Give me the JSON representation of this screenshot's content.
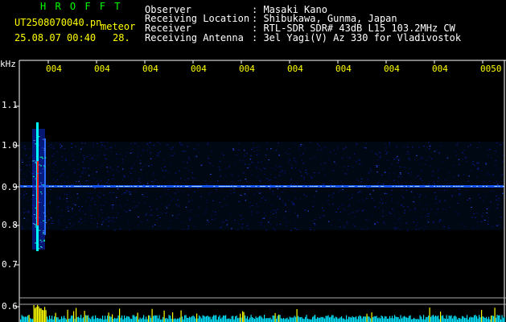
{
  "header": {
    "brand": "H R O F F T",
    "filename": "UT2508070040.pn",
    "mode": "meteor",
    "datetime": "25.08.07 00:40",
    "count": "28.",
    "fields": [
      {
        "label": "Observer",
        "value": ": Masaki Kano"
      },
      {
        "label": "Receiving Location",
        "value": ": Shibukawa, Gunma, Japan"
      },
      {
        "label": "Receiver",
        "value": ": RTL-SDR SDR# 43dB L15 103.2MHz CW"
      },
      {
        "label": "Receiving Antenna",
        "value": ": 3el Yagi(V) Az 330 for Vladivostok"
      }
    ]
  },
  "spectrogram": {
    "unit": "kHz",
    "time_ticks": [
      "004",
      "004",
      "004",
      "004",
      "004",
      "004",
      "004",
      "004",
      "004",
      "0050"
    ],
    "freq_ticks": [
      "1.1",
      "1.0",
      "0.9",
      "0.8",
      "0.7",
      "0.6"
    ],
    "colors": {
      "carrier": "#1a5cff",
      "band": "#0a1a8c",
      "meteor": "#ff2020",
      "meteor_core": "#00ffff",
      "power": "#00e5ff",
      "power_spike": "#ffff00"
    }
  }
}
